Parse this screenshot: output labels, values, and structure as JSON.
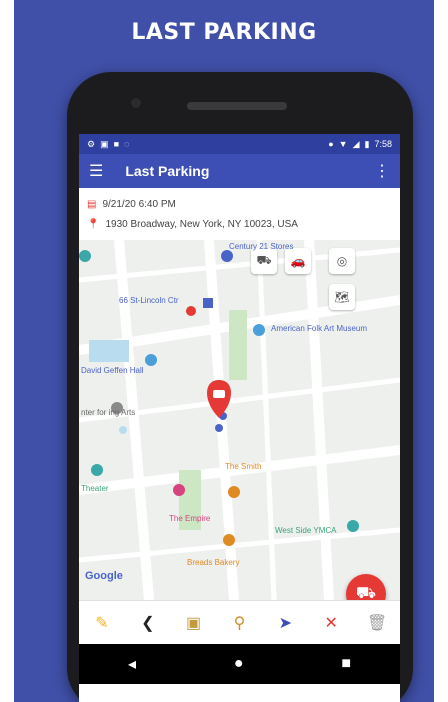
{
  "promo": {
    "headline": "LAST PARKING"
  },
  "statusbar": {
    "time": "7:58"
  },
  "toolbar": {
    "title": "Last Parking"
  },
  "info": {
    "datetime": "9/21/20 6:40 PM",
    "address": "1930 Broadway, New York, NY 10023, USA"
  },
  "map": {
    "labels": {
      "century": "Century 21 Stores",
      "station": "66 St-Lincoln Ctr",
      "museum": "American Folk Art Museum",
      "hall": "David Geffen Hall",
      "performing": "nter for ing Arts",
      "theater": "Theater",
      "smith": "The Smith",
      "empire": "The Empire",
      "ymca": "West Side YMCA",
      "breads": "Breads Bakery"
    },
    "google_logo": "Google",
    "accent": "#e53935"
  },
  "colors": {
    "primary": "#3d4fb4",
    "status": "#2f3fa0",
    "background": "#4050a8"
  }
}
